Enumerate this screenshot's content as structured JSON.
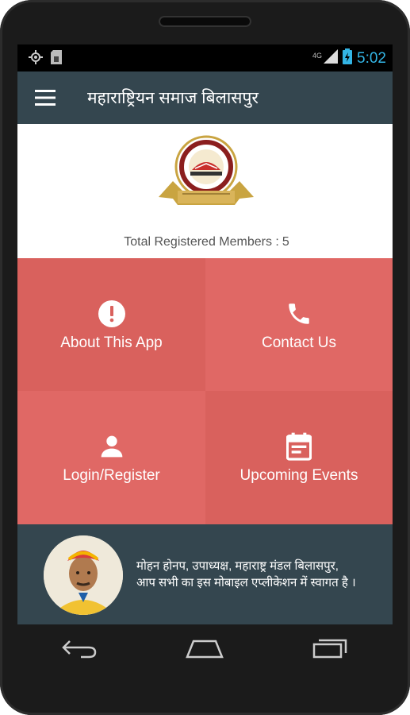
{
  "status_bar": {
    "time": "5:02",
    "network": "4G",
    "icons": [
      "gps-icon",
      "sd-card-icon",
      "signal-icon",
      "battery-charging-icon"
    ]
  },
  "app_bar": {
    "title": "महाराष्ट्रियन समाज बिलासपुर",
    "menu_icon": "hamburger-menu-icon"
  },
  "header": {
    "logo_icon": "organization-emblem-logo",
    "members_label": "Total Registered Members :",
    "members_count": "5"
  },
  "tiles": [
    {
      "label": "About This App",
      "icon": "alert-circle-icon"
    },
    {
      "label": "Contact Us",
      "icon": "phone-icon"
    },
    {
      "label": "Login/Register",
      "icon": "person-icon"
    },
    {
      "label": "Upcoming Events",
      "icon": "calendar-icon"
    }
  ],
  "footer": {
    "avatar_icon": "profile-photo",
    "welcome_line1": "मोहन होनप, उपाध्यक्ष, महाराष्ट्र मंडल बिलासपुर,",
    "welcome_line2": "आप सभी का इस मोबाइल एप्लीकेशन में स्वागत है ।"
  },
  "nav_bar": [
    "back-icon",
    "home-icon",
    "recent-apps-icon"
  ],
  "colors": {
    "app_bar": "#34464f",
    "tile_dark": "#d9615d",
    "tile_light": "#e06865",
    "clock": "#33b5e5"
  }
}
